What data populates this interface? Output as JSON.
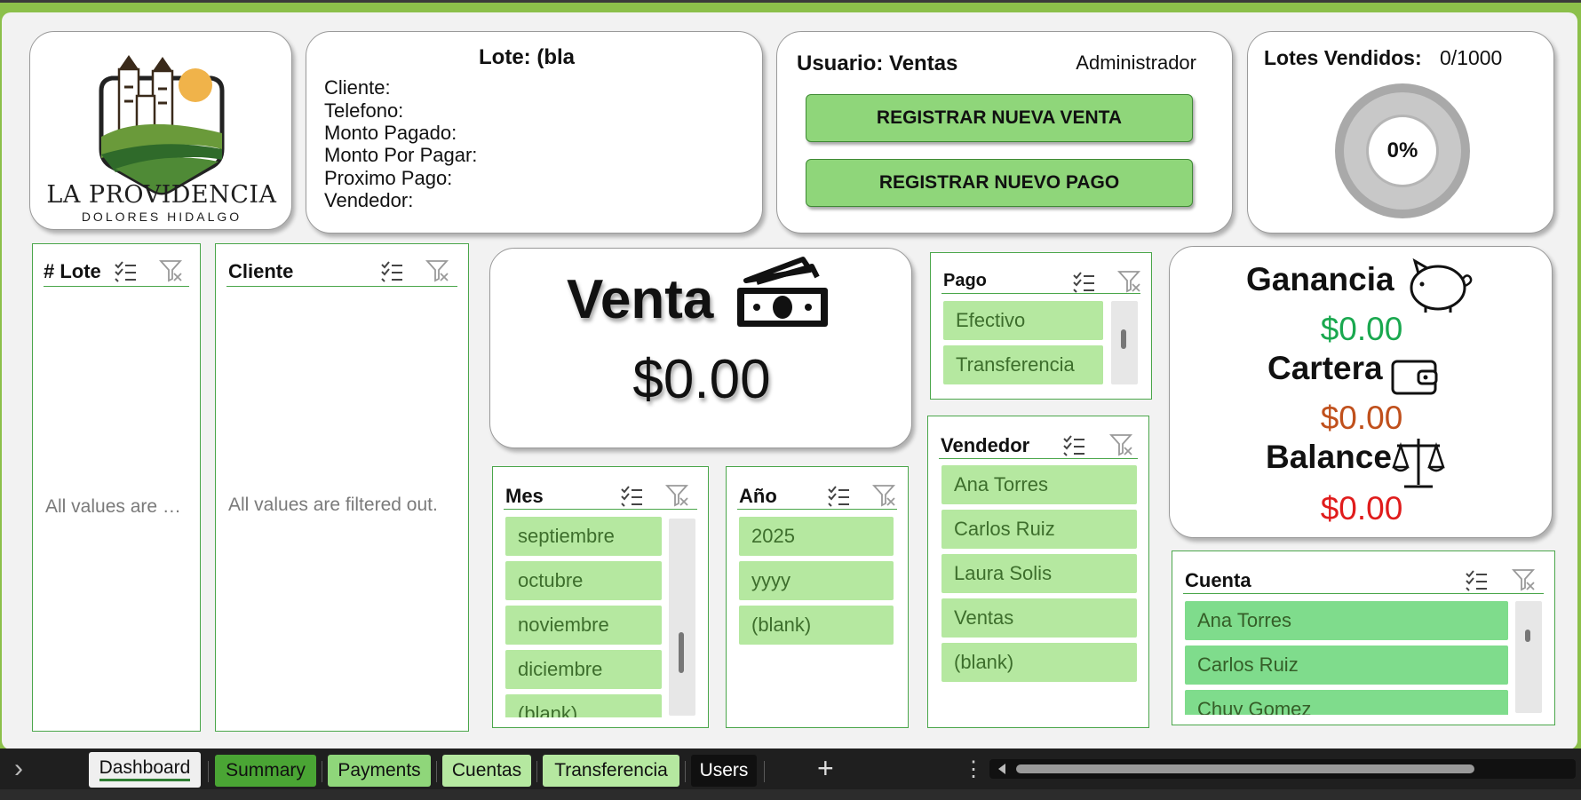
{
  "logo": {
    "title": "LA PROVIDENCIA",
    "subtitle": "DOLORES HIDALGO"
  },
  "lote_panel": {
    "title": "Lote:  (bla",
    "fields": [
      "Cliente:",
      "Telefono:",
      "Monto Pagado:",
      "Monto Por Pagar:",
      "Proximo Pago:",
      "Vendedor:"
    ]
  },
  "user_panel": {
    "user_label": "Usuario: Ventas",
    "role": "Administrador",
    "btn_new_sale": "REGISTRAR NUEVA VENTA",
    "btn_new_payment": "REGISTRAR NUEVO PAGO"
  },
  "lotes_vendidos": {
    "label": "Lotes Vendidos:",
    "value": "0/1000",
    "percent_text": "0%",
    "fraction": 0
  },
  "venta": {
    "title": "Venta",
    "value": "$0.00"
  },
  "kpis": {
    "ganancia": {
      "label": "Ganancia",
      "value": "$0.00",
      "color": "#1aa84f"
    },
    "cartera": {
      "label": "Cartera",
      "value": "$0.00",
      "color": "#c0501c"
    },
    "balance": {
      "label": "Balance",
      "value": "$0.00",
      "color": "#e01c1c"
    }
  },
  "slicers": {
    "lote": {
      "title": "# Lote",
      "empty": "All values are …"
    },
    "cliente": {
      "title": "Cliente",
      "empty": "All values are filtered out."
    },
    "pago": {
      "title": "Pago",
      "items": [
        "Efectivo",
        "Transferencia"
      ]
    },
    "mes": {
      "title": "Mes",
      "items": [
        "septiembre",
        "octubre",
        "noviembre",
        "diciembre",
        "(blank)"
      ]
    },
    "anio": {
      "title": "Año",
      "items": [
        "2025",
        "yyyy",
        "(blank)"
      ]
    },
    "vendedor": {
      "title": "Vendedor",
      "items": [
        "Ana Torres",
        "Carlos Ruiz",
        "Laura Solis",
        "Ventas",
        "(blank)"
      ]
    },
    "cuenta": {
      "title": "Cuenta",
      "items": [
        "Ana Torres",
        "Carlos Ruiz",
        "Chuy Gomez"
      ]
    }
  },
  "tabs": {
    "nav_arrow": "›",
    "items": [
      "Dashboard",
      "Summary",
      "Payments",
      "Cuentas",
      "Transferencia",
      "Users"
    ],
    "active": "Dashboard",
    "add": "+",
    "more": "⋮"
  },
  "colors": {
    "accent_green": "#8cc04a",
    "slicer_border": "#4aa64a",
    "item_fill": "#b5e8a0"
  }
}
